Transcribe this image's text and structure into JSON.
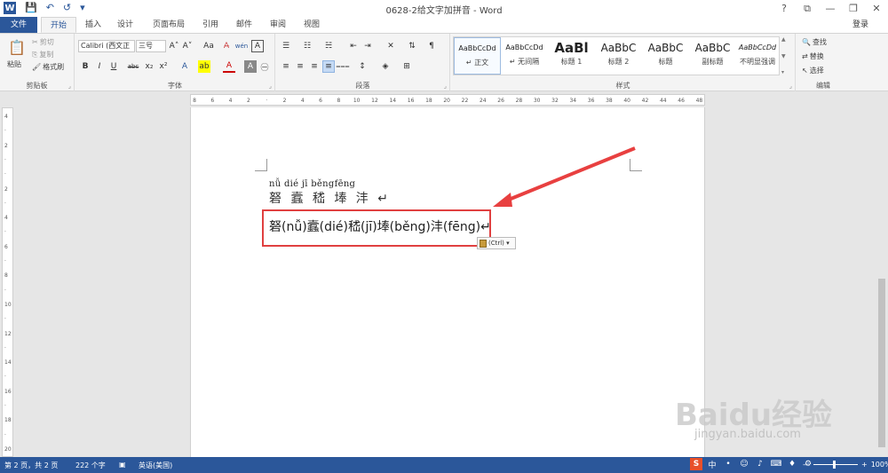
{
  "window": {
    "title": "0628-2给文字加拼音 - Word",
    "controls": [
      "?",
      "⧉",
      "—",
      "❐",
      "✕"
    ]
  },
  "qat": {
    "save": "💾",
    "undo": "↶",
    "redo": "↺",
    "more": "▾"
  },
  "tabs": [
    "文件",
    "开始",
    "插入",
    "设计",
    "页面布局",
    "引用",
    "邮件",
    "审阅",
    "视图"
  ],
  "active_tab": "开始",
  "login": "登录",
  "clipboard": {
    "paste": "粘贴",
    "cut": "剪切",
    "copy": "复制",
    "format_painter": "格式刷",
    "label": "剪贴板"
  },
  "font": {
    "name": "Calibri (西文正",
    "size": "三号",
    "label": "字体",
    "bold": "B",
    "italic": "I",
    "underline": "U",
    "strike": "abc",
    "sub": "x₂",
    "sup": "x²",
    "grow": "A˄",
    "shrink": "A˅",
    "case": "Aa",
    "clear": "A̶",
    "pinyin": "wén",
    "border": "A",
    "effect": "A",
    "highlight": "ab",
    "color": "A",
    "shade": "A",
    "circle": "㊀"
  },
  "paragraph": {
    "label": "段落"
  },
  "styles": {
    "label": "样式",
    "items": [
      {
        "preview": "AaBbCcDd",
        "name": "↵ 正文"
      },
      {
        "preview": "AaBbCcDd",
        "name": "↵ 无间隔"
      },
      {
        "preview": "AaBl",
        "name": "标题 1"
      },
      {
        "preview": "AaBbC",
        "name": "标题 2"
      },
      {
        "preview": "AaBbC",
        "name": "标题"
      },
      {
        "preview": "AaBbC",
        "name": "副标题"
      },
      {
        "preview": "AaBbCcDd",
        "name": "不明显强调"
      }
    ]
  },
  "editing": {
    "find": "查找",
    "replace": "替换",
    "select": "选择",
    "label": "编辑"
  },
  "hruler": [
    "8",
    "6",
    "4",
    "2",
    "",
    "2",
    "4",
    "6",
    "8",
    "10",
    "12",
    "14",
    "16",
    "18",
    "20",
    "22",
    "24",
    "26",
    "28",
    "30",
    "32",
    "34",
    "36",
    "38",
    "40",
    "42",
    "44",
    "46",
    "48"
  ],
  "vruler": [
    "4",
    "",
    "2",
    "",
    "",
    "2",
    "",
    "4",
    "",
    "6",
    "",
    "8",
    "",
    "10",
    "",
    "12",
    "",
    "14",
    "",
    "16",
    "",
    "18",
    "",
    "20"
  ],
  "document": {
    "pinyin_line": "nǚ dié jī běngfēng",
    "hanzi_line": "砮 蠧 嵇 埲 沣 ↵",
    "result_line": "砮(nǚ)蠧(dié)嵇(jī)埲(běng)沣(fēng)↵",
    "paste_label": "(Ctrl) ▾"
  },
  "status": {
    "page": "第 2 页，共 2 页",
    "words": "222 个字",
    "lang": "英语(美国)",
    "zoom": "100%"
  },
  "watermark": {
    "brand": "Baidu经验",
    "url": "jingyan.baidu.com"
  }
}
